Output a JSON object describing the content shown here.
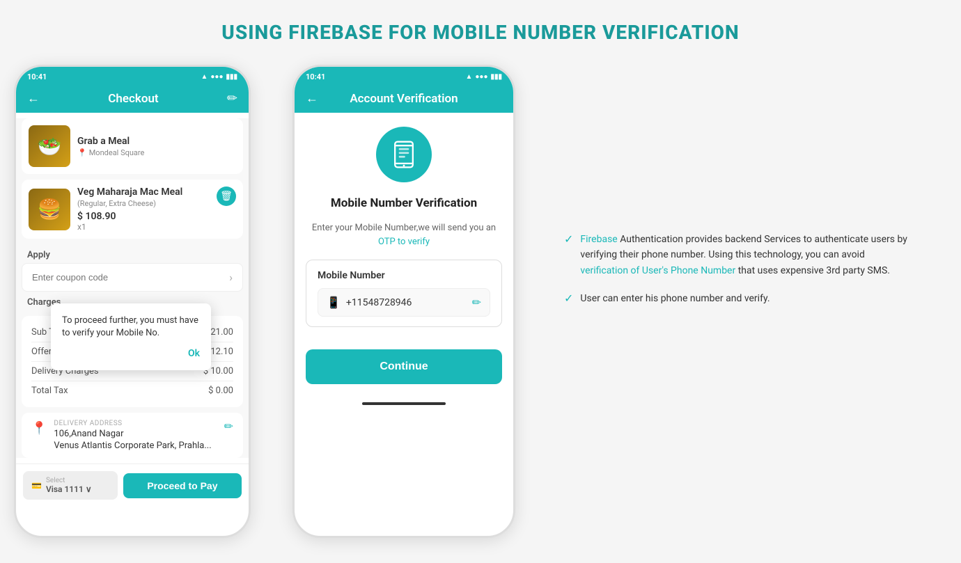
{
  "page": {
    "title": "USING FIREBASE FOR MOBILE NUMBER VERIFICATION"
  },
  "phone1": {
    "status_time": "10:41",
    "nav_title": "Checkout",
    "meal1": {
      "name": "Grab a Meal",
      "location": "Mondeal Square",
      "emoji": "🥗"
    },
    "meal2": {
      "name": "Veg Maharaja Mac Meal",
      "desc": "(Regular, Extra Cheese)",
      "price": "$ 108.90",
      "qty": "x1",
      "emoji": "🍔"
    },
    "apply_label": "Apply",
    "charges_label": "Charges",
    "charges": [
      {
        "label": "Sub Total",
        "value": "$ 121.00"
      },
      {
        "label": "Offers Discount",
        "value": "- $ 12.10"
      },
      {
        "label": "Delivery Charges",
        "value": "$ 10.00"
      },
      {
        "label": "Total Tax",
        "value": "$ 0.00"
      }
    ],
    "address_label": "DELIVERY ADDRESS",
    "address_line1": "106,Anand Nagar",
    "address_line2": "Venus Atlantis Corporate Park, Prahla...",
    "payment_label": "Select",
    "payment_sub": "Visa 1111 ∨",
    "proceed_btn": "Proceed to Pay",
    "popup": {
      "message": "To proceed further, you must have to verify your Mobile No.",
      "ok_label": "Ok"
    }
  },
  "phone2": {
    "status_time": "10:41",
    "nav_title": "Account Verification",
    "verification_title": "Mobile Number  Verification",
    "verification_sub1": "Enter your Mobile Number,we will send you an",
    "verification_sub2": "OTP to verify",
    "mobile_label": "Mobile Number",
    "mobile_number": "+11548728946",
    "continue_btn": "Continue"
  },
  "info": {
    "items": [
      {
        "text_parts": [
          {
            "text": "Firebase ",
            "highlight": true
          },
          {
            "text": "Authentication provides backend Services to authenticate users by verifying their phone number. Using this technology, you can avoid ",
            "highlight": false
          },
          {
            "text": "verification of User's Phone Number",
            "highlight": true
          },
          {
            "text": " that uses expensive 3rd party SMS.",
            "highlight": false
          }
        ]
      },
      {
        "text_parts": [
          {
            "text": "User can enter his phone number and verify.",
            "highlight": false
          }
        ]
      }
    ]
  }
}
